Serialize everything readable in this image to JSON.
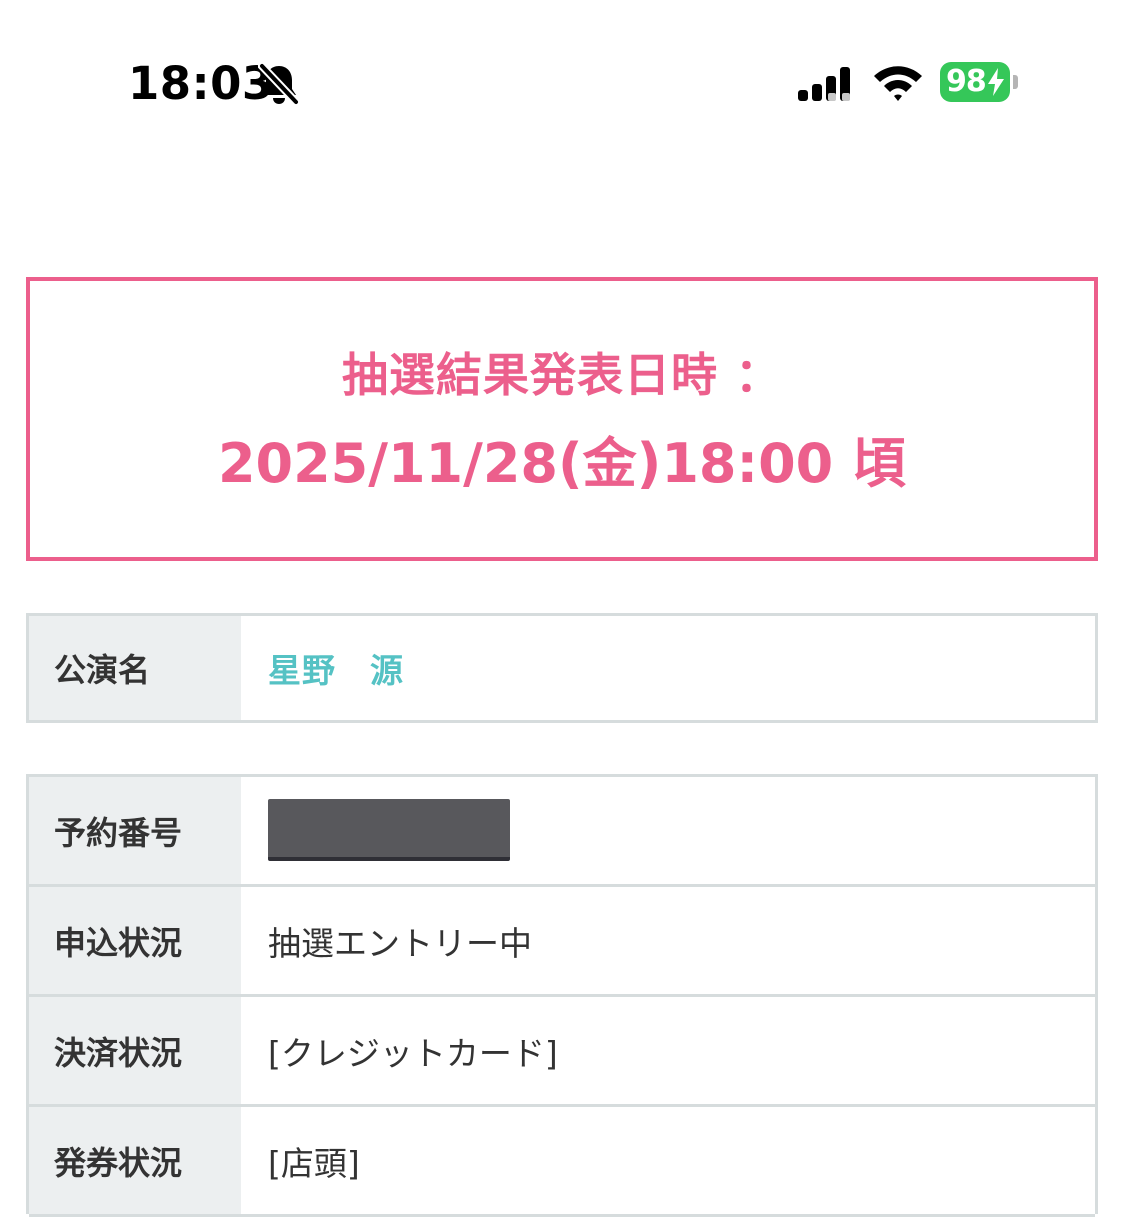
{
  "status_bar": {
    "time": "18:03",
    "battery_percent": "98",
    "battery_level": 0.98,
    "signal_bars_active": 2,
    "signal_bars_total": 4,
    "icons": [
      "bell-slash-icon",
      "cellular-signal-icon",
      "wifi-icon",
      "battery-charging-icon"
    ],
    "battery_color": "#35c759"
  },
  "announcement": {
    "label": "抽選結果発表日時 ：",
    "datetime": "2025/11/28(金)18:00 頃",
    "accent_color": "#ec5f8c"
  },
  "performance": {
    "label": "公演名",
    "value": "星野　源",
    "value_color": "#55c2c4"
  },
  "details": {
    "rows": [
      {
        "label": "予約番号",
        "value": "",
        "redacted": true
      },
      {
        "label": "申込状況",
        "value": "抽選エントリー中"
      },
      {
        "label": "決済状況",
        "value": "[クレジットカード]"
      },
      {
        "label": "発券状況",
        "value": "[店頭]"
      }
    ]
  }
}
